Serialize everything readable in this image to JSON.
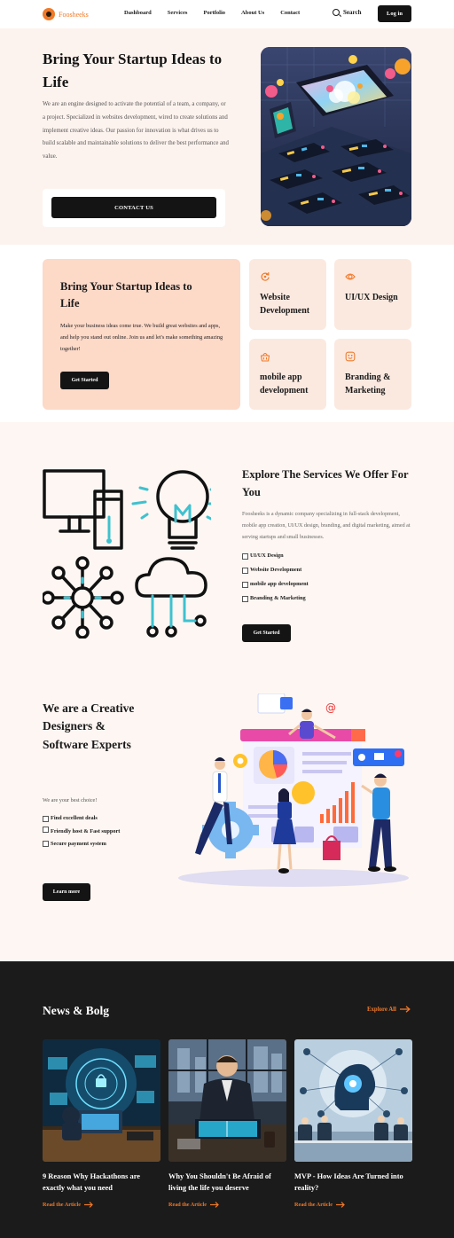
{
  "nav": {
    "logo_text": "Foosheeks",
    "links": [
      "Dashboard",
      "Services",
      "Portfolio",
      "About Us",
      "Contact"
    ],
    "search_label": "Search",
    "login_label": "Log in"
  },
  "hero": {
    "title": "Bring Your Startup Ideas to Life",
    "text": "We are an engine designed to activate the potential of a team, a company, or a project. Specialized in websites development, wired to create solutions and implement creative ideas. Our passion for innovation is what drives us to build scalable and maintainable solutions to deliver the best performance and value.",
    "cta_label": "CONTACT US"
  },
  "services": {
    "main_title": "Bring Your Startup Ideas to Life",
    "main_text": "Make your business ideas come true. We build great websites and apps, and help you stand out online. Join us and let's make something amazing together!",
    "main_button": "Get Started",
    "cards": [
      {
        "label": "Website Development",
        "icon": "refresh-icon"
      },
      {
        "label": "UI/UX Design",
        "icon": "eye-icon"
      },
      {
        "label": "mobile app development",
        "icon": "basket-icon"
      },
      {
        "label": "Branding & Marketing",
        "icon": "face-icon"
      }
    ],
    "accent_color": "#f07a2a"
  },
  "explore": {
    "title": "Explore The Services We Offer For You",
    "text": "Foosheeks is a dynamic company specializing in full-stack development, mobile app creation, UI/UX design, branding, and digital marketing, aimed at serving startups and small businesses.",
    "items": [
      "UI/UX Design",
      "Website Development",
      "mobile app development",
      "Branding & Marketing"
    ],
    "button": "Get Started"
  },
  "creative": {
    "title": "We are a Creative Designers & Software Experts",
    "subtitle": "We are your best choice!",
    "items": [
      "Find excellent deals",
      "Friendly host & Fast support",
      "Secure payment system"
    ],
    "button": "Learn more"
  },
  "news": {
    "title": "News & Bolg",
    "explore_all": "Explore All",
    "read_label": "Read the Article",
    "articles": [
      {
        "title": "9 Reason Why Hackathons are exactly what you need"
      },
      {
        "title": "Why You Shouldn't Be Afraid of living the life you deserve"
      },
      {
        "title": "MVP - How Ideas Are Turned into reality?"
      }
    ]
  }
}
